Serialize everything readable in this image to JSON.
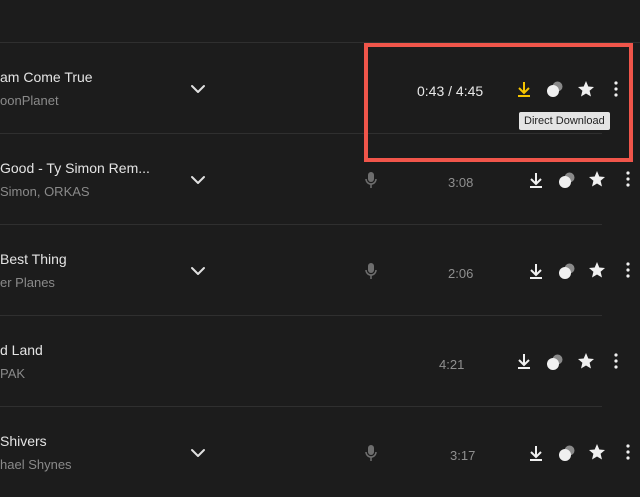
{
  "tracks": [
    {
      "title": "am Come True",
      "artist": "oonPlanet",
      "duration": "0:43 / 4:45"
    },
    {
      "title": "Good - Ty Simon Rem...",
      "artist": "Simon, ORKAS",
      "duration": "3:08"
    },
    {
      "title": " Best Thing",
      "artist": "er Planes",
      "duration": "2:06"
    },
    {
      "title": "d Land",
      "artist": "PAK",
      "duration": "4:21"
    },
    {
      "title": " Shivers",
      "artist": "hael Shynes",
      "duration": "3:17"
    }
  ],
  "tooltip": "Direct Download",
  "colors": {
    "accent_download": "#f5c400",
    "highlight_border": "#f0554a"
  },
  "icons": [
    "chevron-down-icon",
    "microphone-icon",
    "download-icon",
    "mix-icon",
    "star-icon",
    "more-vertical-icon"
  ]
}
